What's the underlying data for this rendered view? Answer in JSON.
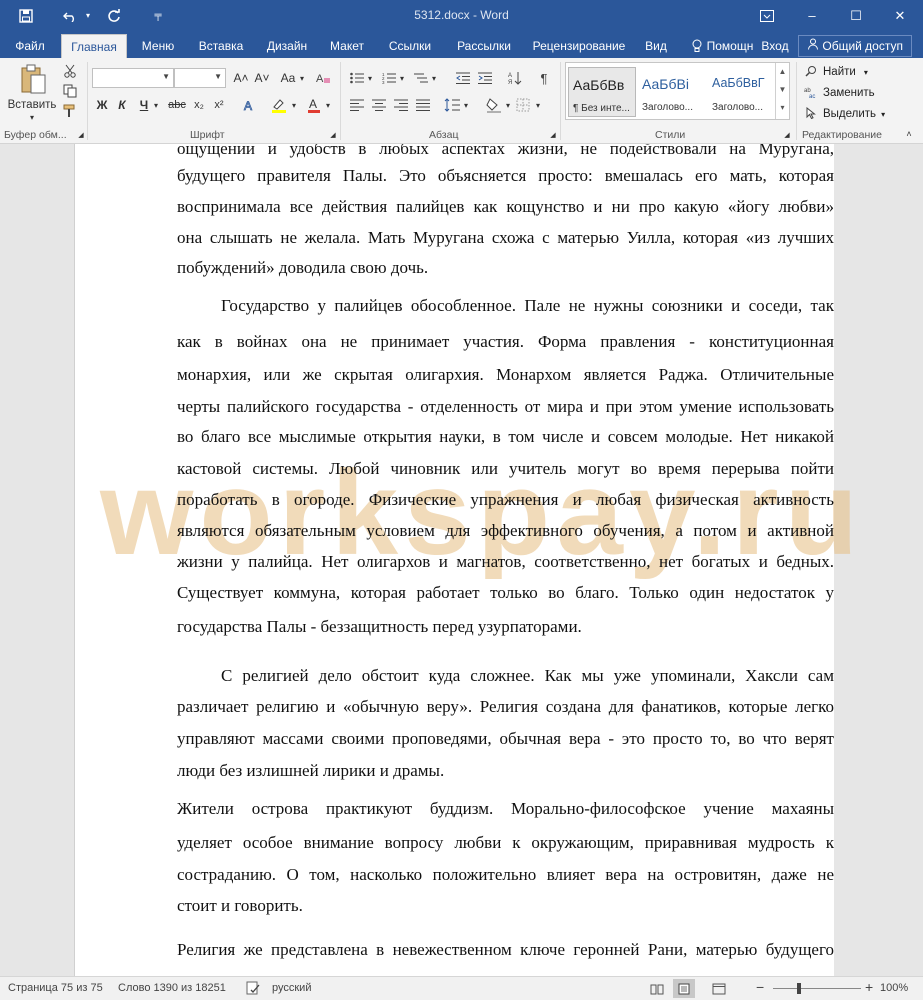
{
  "app": {
    "doc_title": "5312.docx - Word",
    "quick_access": {
      "save_icon": "save-icon",
      "undo_icon": "undo-icon",
      "redo_icon": "redo-icon",
      "customize_icon": "customize-icon"
    },
    "window_buttons": {
      "ribbon_icon": "ribbon-display-icon",
      "minimize": "–",
      "maximize": "☐",
      "close": "✕"
    }
  },
  "tabs": [
    {
      "label": "Файл"
    },
    {
      "label": "Главная"
    },
    {
      "label": "Меню"
    },
    {
      "label": "Вставка"
    },
    {
      "label": "Дизайн"
    },
    {
      "label": "Макет"
    },
    {
      "label": "Ссылки"
    },
    {
      "label": "Рассылки"
    },
    {
      "label": "Рецензирование"
    },
    {
      "label": "Вид"
    },
    {
      "label": "Помощн"
    },
    {
      "label": "Вход"
    }
  ],
  "share_label": "Общий доступ",
  "ribbon": {
    "paste_label": "Вставить",
    "groups": {
      "clipboard": "Буфер обм...",
      "font": "Шрифт",
      "paragraph": "Абзац",
      "styles": "Стили",
      "editing": "Редактирование"
    },
    "font": {
      "name_value": "",
      "size_value": "",
      "grow": "A˄",
      "shrink": "A˅",
      "case": "Aa",
      "bold": "Ж",
      "italic": "К",
      "underline": "Ч",
      "strike": "abc",
      "subscript": "x₂",
      "superscript": "x²"
    },
    "styles": [
      {
        "sample": "АаБбВв",
        "name": "¶ Без инте..."
      },
      {
        "sample": "АаБбВі",
        "name": "Заголово..."
      },
      {
        "sample": "АаБбВвГ",
        "name": "Заголово..."
      }
    ],
    "editing": {
      "find": "Найти",
      "replace": "Заменить",
      "select": "Выделить"
    }
  },
  "document": {
    "watermark": "workspay.ru",
    "lines": [
      "ощущении и удобств в любых аспектах жизни, не подействовали на Муругана,",
      "будущего правителя Палы. Это объясняется просто: вмешалась его мать, которая",
      "воспринимала все действия палийцев как кощунство и ни про какую «йогу любви»",
      "она слышать не желала. Мать Муругана схожа с матерью Уилла, которая «из лучших",
      "побуждений» доводила свою дочь.",
      "Государство у палийцев обособленное. Пале не нужны союзники и соседи, так",
      "как в войнах она не принимает участия. Форма правления - конституционная",
      "монархия, или же скрытая олигархия. Монархом является Раджа. Отличительные",
      "черты палийского государства - отделенность от мира и при этом умение использовать",
      "во благо все мыслимые открытия науки, в том числе и совсем молодые. Нет никакой",
      "кастовой системы. Любой чиновник или учитель могут во время перерыва пойти",
      "поработать в огороде. Физические упражнения и любая физическая активность",
      "являются обязательным условием для эффективного обучения, а потом и активной",
      "жизни у палийца. Нет олигархов и магнатов, соответственно, нет богатых и бедных.",
      "Существует коммуна, которая работает только во благо. Только один недостаток у",
      "государства Палы - беззащитность перед узурпаторами.",
      "С религией дело обстоит куда сложнее. Как мы уже упоминали, Хаксли сам",
      "различает религию и «обычную веру». Религия создана для фанатиков, которые легко",
      "управляют массами своими проповедями, обычная вера - это просто то, во что верят",
      "люди без излишней лирики и драмы.",
      "Жители острова практикуют буддизм. Морально-философское учение махаяны",
      "уделяет особое внимание вопросу любви к окружающим, приравнивая мудрость к",
      "состраданию. О том, насколько положительно влияет вера на островитян, даже не",
      "стоит и говорить.",
      "Религия же представлена в невежественном ключе геронней Рани, матерью будущего"
    ]
  },
  "status": {
    "page": "Страница 75 из 75",
    "words": "Слово 1390 из 18251",
    "language": "русский",
    "zoom": "100%",
    "zoom_minus": "−",
    "zoom_plus": "+"
  }
}
